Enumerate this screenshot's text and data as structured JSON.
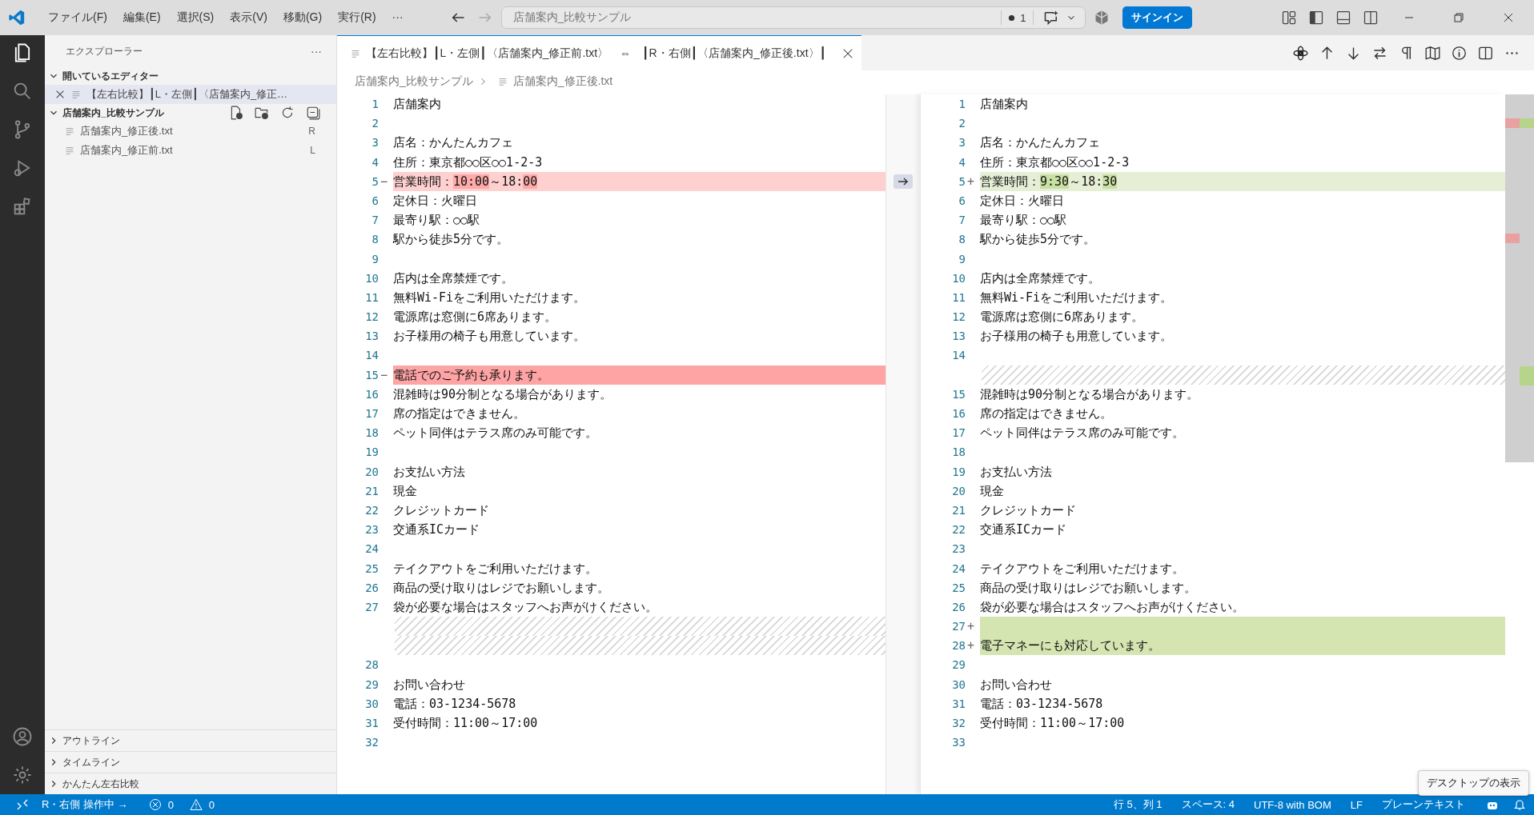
{
  "title_bar": {
    "menus": [
      "ファイル(F)",
      "編集(E)",
      "選択(S)",
      "表示(V)",
      "移動(G)",
      "実行(R)",
      "···"
    ],
    "search": {
      "value": "店舗案内_比較サンプル"
    },
    "problems_count": "1",
    "sign_in": "サインイン"
  },
  "activity_bar": [
    {
      "kind": "files",
      "selected": true
    },
    {
      "kind": "search",
      "selected": false
    },
    {
      "kind": "branch",
      "selected": false
    },
    {
      "kind": "run",
      "selected": false
    },
    {
      "kind": "extensions",
      "selected": false
    }
  ],
  "sidebar": {
    "title": "エクスプローラー",
    "more": "···",
    "open_editors": {
      "label": "開いているエディター",
      "expanded": true,
      "items": [
        {
          "name": "【左右比較】┃L・左側┃〈店舗案内_修正…",
          "selected": true
        }
      ]
    },
    "folder": {
      "label": "店舗案内_比較サンプル",
      "expanded": true,
      "files": [
        {
          "name": "店舗案内_修正後.txt",
          "badge": "R"
        },
        {
          "name": "店舗案内_修正前.txt",
          "badge": "L"
        }
      ]
    },
    "sections": [
      {
        "label": "アウトライン",
        "expanded": false
      },
      {
        "label": "タイムライン",
        "expanded": false
      },
      {
        "label": "かんたん左右比較",
        "expanded": false
      }
    ]
  },
  "tabs": [
    {
      "label": "【左右比較】┃L・左側┃〈店舗案内_修正前.txt〉　⇔　┃R・右側┃〈店舗案内_修正後.txt〉┃",
      "selected": true
    }
  ],
  "breadcrumb": [
    "店舗案内_比較サンプル",
    "店舗案内_修正後.txt"
  ],
  "left_pane": [
    {
      "no": "1",
      "kind": "normal",
      "text": "店舗案内"
    },
    {
      "no": "2",
      "kind": "normal"
    },
    {
      "no": "3",
      "kind": "normal",
      "text": "店名：かんたんカフェ"
    },
    {
      "no": "4",
      "kind": "normal",
      "text": "住所：東京都○○区○○1-2-3"
    },
    {
      "no": "5",
      "kind": "modified",
      "sign": "−",
      "revert": true,
      "segments": [
        {
          "text": "営業時間：",
          "changed": false
        },
        {
          "text": "10:00",
          "changed": true
        },
        {
          "text": "～18:",
          "changed": false
        },
        {
          "text": "00",
          "changed": true
        }
      ]
    },
    {
      "no": "6",
      "kind": "normal",
      "text": "定休日：火曜日"
    },
    {
      "no": "7",
      "kind": "normal",
      "text": "最寄り駅：○○駅"
    },
    {
      "no": "8",
      "kind": "normal",
      "text": "駅から徒歩5分です。"
    },
    {
      "no": "9",
      "kind": "normal"
    },
    {
      "no": "10",
      "kind": "normal",
      "text": "店内は全席禁煙です。"
    },
    {
      "no": "11",
      "kind": "normal",
      "text": "無料Wi-Fiをご利用いただけます。"
    },
    {
      "no": "12",
      "kind": "normal",
      "text": "電源席は窓側に6席あります。"
    },
    {
      "no": "13",
      "kind": "normal",
      "text": "お子様用の椅子も用意しています。"
    },
    {
      "no": "14",
      "kind": "normal"
    },
    {
      "no": "15",
      "kind": "removed",
      "sign": "−",
      "text": "電話でのご予約も承ります。"
    },
    {
      "no": "16",
      "kind": "normal",
      "text": "混雑時は90分制となる場合があります。"
    },
    {
      "no": "17",
      "kind": "normal",
      "text": "席の指定はできません。"
    },
    {
      "no": "18",
      "kind": "normal",
      "text": "ペット同伴はテラス席のみ可能です。"
    },
    {
      "no": "19",
      "kind": "normal"
    },
    {
      "no": "20",
      "kind": "normal",
      "text": "お支払い方法"
    },
    {
      "no": "21",
      "kind": "normal",
      "text": "現金"
    },
    {
      "no": "22",
      "kind": "normal",
      "text": "クレジットカード"
    },
    {
      "no": "23",
      "kind": "normal",
      "text": "交通系ICカード"
    },
    {
      "no": "24",
      "kind": "normal"
    },
    {
      "no": "25",
      "kind": "normal",
      "text": "テイクアウトをご利用いただけます。"
    },
    {
      "no": "26",
      "kind": "normal",
      "text": "商品の受け取りはレジでお願いします。"
    },
    {
      "no": "27",
      "kind": "normal",
      "text": "袋が必要な場合はスタッフへお声がけください。"
    },
    {
      "kind": "filler"
    },
    {
      "kind": "filler"
    },
    {
      "no": "28",
      "kind": "normal"
    },
    {
      "no": "29",
      "kind": "normal",
      "text": "お問い合わせ"
    },
    {
      "no": "30",
      "kind": "normal",
      "text": "電話：03-1234-5678"
    },
    {
      "no": "31",
      "kind": "normal",
      "text": "受付時間：11:00～17:00"
    },
    {
      "no": "32",
      "kind": "normal"
    }
  ],
  "right_pane": [
    {
      "no": "1",
      "kind": "normal",
      "text": "店舗案内"
    },
    {
      "no": "2",
      "kind": "normal"
    },
    {
      "no": "3",
      "kind": "normal",
      "text": "店名：かんたんカフェ"
    },
    {
      "no": "4",
      "kind": "normal",
      "text": "住所：東京都○○区○○1-2-3"
    },
    {
      "no": "5",
      "kind": "modified",
      "sign": "+",
      "segments": [
        {
          "text": "営業時間：",
          "changed": false
        },
        {
          "text": "9:30",
          "changed": true
        },
        {
          "text": "～18:",
          "changed": false
        },
        {
          "text": "30",
          "changed": true
        }
      ]
    },
    {
      "no": "6",
      "kind": "normal",
      "text": "定休日：火曜日"
    },
    {
      "no": "7",
      "kind": "normal",
      "text": "最寄り駅：○○駅"
    },
    {
      "no": "8",
      "kind": "normal",
      "text": "駅から徒歩5分です。"
    },
    {
      "no": "9",
      "kind": "normal"
    },
    {
      "no": "10",
      "kind": "normal",
      "text": "店内は全席禁煙です。"
    },
    {
      "no": "11",
      "kind": "normal",
      "text": "無料Wi-Fiをご利用いただけます。"
    },
    {
      "no": "12",
      "kind": "normal",
      "text": "電源席は窓側に6席あります。"
    },
    {
      "no": "13",
      "kind": "normal",
      "text": "お子様用の椅子も用意しています。"
    },
    {
      "no": "14",
      "kind": "normal"
    },
    {
      "kind": "filler"
    },
    {
      "no": "15",
      "kind": "normal",
      "text": "混雑時は90分制となる場合があります。"
    },
    {
      "no": "16",
      "kind": "normal",
      "text": "席の指定はできません。"
    },
    {
      "no": "17",
      "kind": "normal",
      "text": "ペット同伴はテラス席のみ可能です。"
    },
    {
      "no": "18",
      "kind": "normal"
    },
    {
      "no": "19",
      "kind": "normal",
      "text": "お支払い方法"
    },
    {
      "no": "20",
      "kind": "normal",
      "text": "現金"
    },
    {
      "no": "21",
      "kind": "normal",
      "text": "クレジットカード"
    },
    {
      "no": "22",
      "kind": "normal",
      "text": "交通系ICカード"
    },
    {
      "no": "23",
      "kind": "normal"
    },
    {
      "no": "24",
      "kind": "normal",
      "text": "テイクアウトをご利用いただけます。"
    },
    {
      "no": "25",
      "kind": "normal",
      "text": "商品の受け取りはレジでお願いします。"
    },
    {
      "no": "26",
      "kind": "normal",
      "text": "袋が必要な場合はスタッフへお声がけください。"
    },
    {
      "no": "27",
      "kind": "added",
      "sign": "+"
    },
    {
      "no": "28",
      "kind": "added",
      "sign": "+",
      "text": "電子マネーにも対応しています。"
    },
    {
      "no": "29",
      "kind": "normal"
    },
    {
      "no": "30",
      "kind": "normal",
      "text": "お問い合わせ"
    },
    {
      "no": "31",
      "kind": "normal",
      "text": "電話：03-1234-5678"
    },
    {
      "no": "32",
      "kind": "normal",
      "text": "受付時間：11:00～17:00"
    },
    {
      "no": "33",
      "kind": "normal"
    }
  ],
  "status_bar": {
    "mode": "R・右側 操作中 →",
    "errors": "0",
    "warnings": "0",
    "position": "行 5、列 1",
    "indent": "スペース: 4",
    "encoding": "UTF-8 with BOM",
    "eol": "LF",
    "language": "プレーンテキスト"
  },
  "tooltip": "デスクトップの表示"
}
